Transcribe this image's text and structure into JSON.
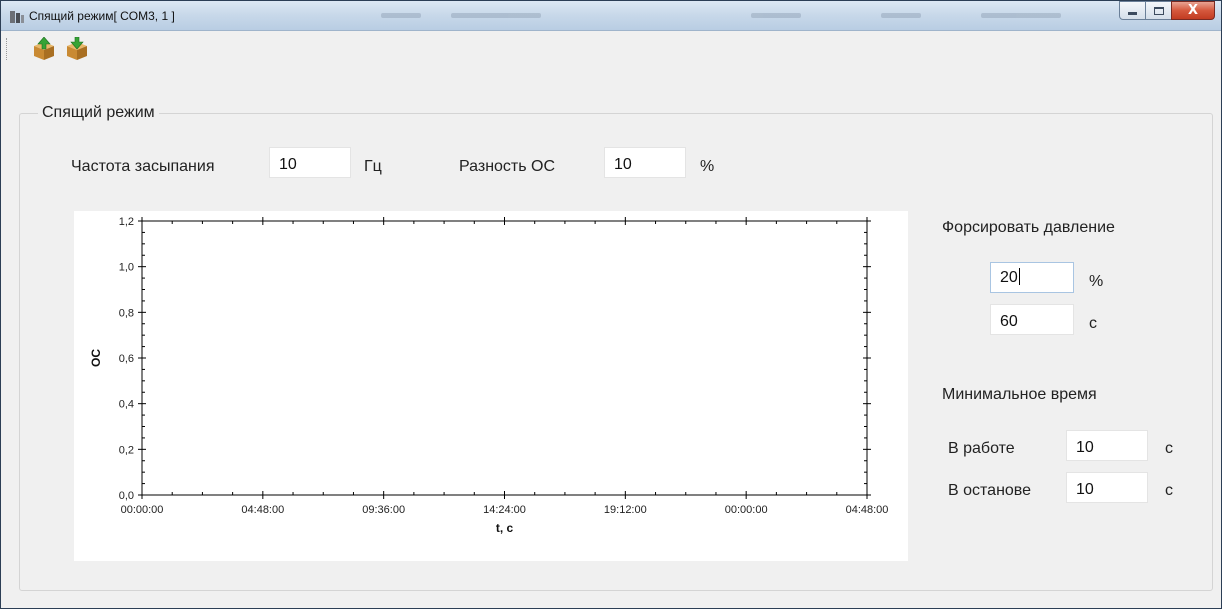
{
  "window": {
    "title": "Спящий режим[ COM3, 1 ]",
    "close_symbol": "X",
    "accent": "#c23c22"
  },
  "toolbar": {
    "buttons": [
      {
        "name": "upload",
        "icon": "box-arrow-up-icon"
      },
      {
        "name": "download",
        "icon": "box-arrow-down-icon"
      }
    ]
  },
  "group": {
    "title": "Спящий режим"
  },
  "params": {
    "sleep_freq_label": "Частота засыпания",
    "sleep_freq_value": "10",
    "sleep_freq_unit": "Гц",
    "fb_diff_label": "Разность ОС",
    "fb_diff_value": "10",
    "fb_diff_unit": "%"
  },
  "boost": {
    "title": "Форсировать давление",
    "percent_value": "20",
    "percent_unit": "%",
    "time_value": "60",
    "time_unit": "с"
  },
  "min_time": {
    "title": "Минимальное время",
    "run_label": "В работе",
    "run_value": "10",
    "run_unit": "с",
    "stop_label": "В останове",
    "stop_value": "10",
    "stop_unit": "с"
  },
  "chart_data": {
    "type": "line",
    "xlabel": "t, c",
    "ylabel": "ОС",
    "ylim": [
      0,
      1.2
    ],
    "y_ticks": [
      "0,0",
      "0,2",
      "0,4",
      "0,6",
      "0,8",
      "1,0",
      "1,2"
    ],
    "x_ticks": [
      "00:00:00",
      "04:48:00",
      "09:36:00",
      "14:24:00",
      "19:12:00",
      "00:00:00",
      "04:48:00"
    ],
    "series": [],
    "grid": false
  }
}
